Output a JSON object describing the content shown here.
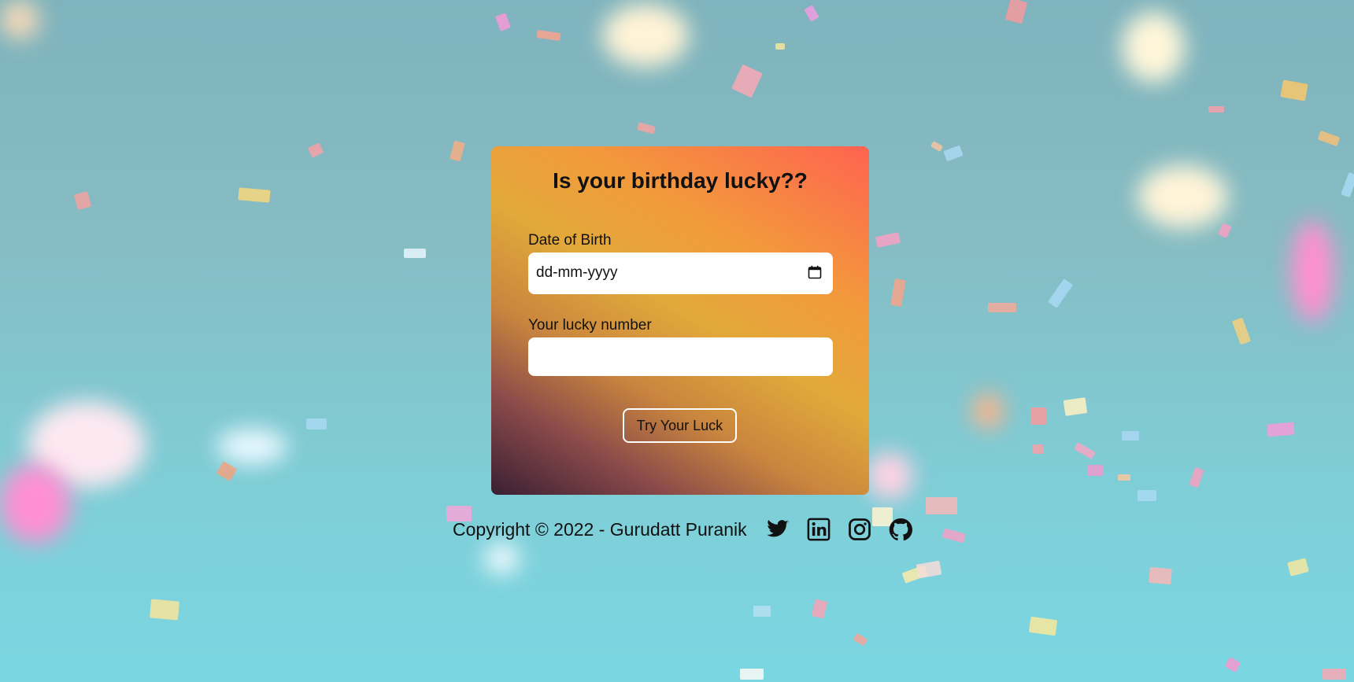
{
  "card": {
    "title": "Is your birthday lucky??",
    "dob_label": "Date of Birth",
    "dob_placeholder": "dd-mm-yyyy",
    "lucky_label": "Your lucky number",
    "lucky_value": "",
    "button_label": "Try Your Luck"
  },
  "footer": {
    "copyright": "Copyright © 2022 - Gurudatt Puranik",
    "social": [
      {
        "icon": "twitter-icon"
      },
      {
        "icon": "linkedin-icon"
      },
      {
        "icon": "instagram-icon"
      },
      {
        "icon": "github-icon"
      }
    ]
  },
  "colors": {
    "background": "#86bcc3",
    "card_gradient_start": "#3a1f33",
    "card_gradient_mid": "#e2a93a",
    "card_gradient_end": "#ff6350",
    "button_border": "#ffffff"
  }
}
